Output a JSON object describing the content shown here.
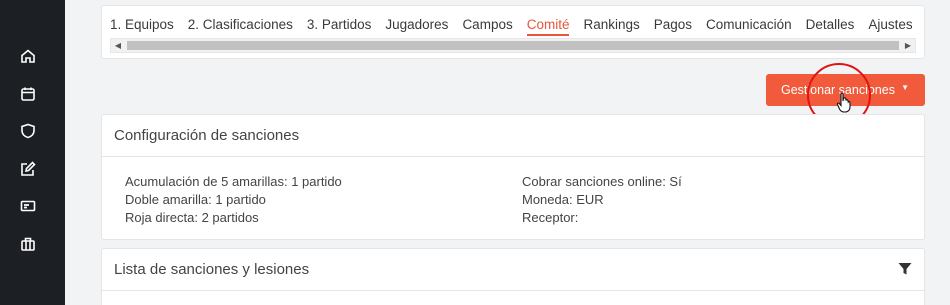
{
  "tabs": [
    {
      "label": "1. Equipos"
    },
    {
      "label": "2. Clasificaciones"
    },
    {
      "label": "3. Partidos"
    },
    {
      "label": "Jugadores"
    },
    {
      "label": "Campos"
    },
    {
      "label": "Comité",
      "active": true
    },
    {
      "label": "Rankings"
    },
    {
      "label": "Pagos"
    },
    {
      "label": "Comunicación"
    },
    {
      "label": "Detalles"
    },
    {
      "label": "Ajustes"
    }
  ],
  "scrollbar": {
    "left_arrow": "◀",
    "right_arrow": "▶"
  },
  "manage_button": {
    "label": "Gestionar sanciones",
    "caret": "▼"
  },
  "config": {
    "title": "Configuración de sanciones",
    "left": [
      "Acumulación de 5 amarillas: 1 partido",
      "Doble amarilla: 1 partido",
      "Roja directa: 2 partidos"
    ],
    "right": [
      "Cobrar sanciones online: Sí",
      "Moneda: EUR",
      "Receptor:"
    ]
  },
  "list": {
    "title": "Lista de sanciones y lesiones"
  },
  "sidebar_icons": [
    "home-icon",
    "calendar-icon",
    "shield-icon",
    "edit-icon",
    "card-icon",
    "briefcase-icon"
  ],
  "colors": {
    "accent": "#f15a3b",
    "sidebar": "#1c1f23"
  }
}
